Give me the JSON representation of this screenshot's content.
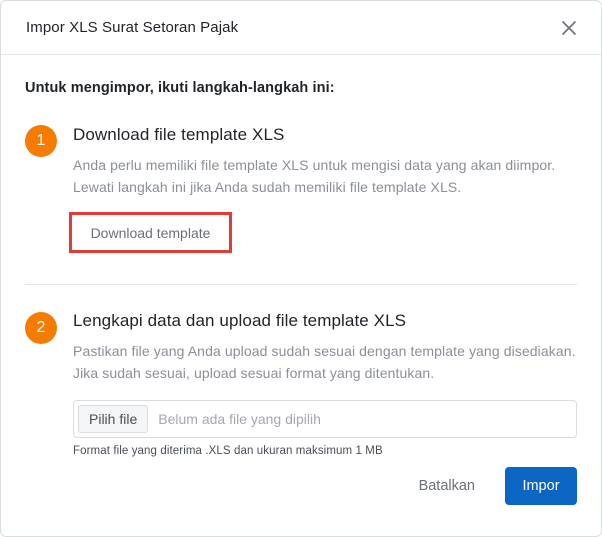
{
  "dialog": {
    "title": "Impor XLS Surat Setoran Pajak",
    "close_icon": "close-icon"
  },
  "intro": "Untuk mengimpor, ikuti langkah-langkah ini:",
  "steps": [
    {
      "number": "1",
      "title": "Download file template XLS",
      "description": "Anda perlu memiliki file template XLS untuk mengisi data yang akan diimpor. Lewati langkah ini jika Anda sudah memiliki file template XLS.",
      "button_label": "Download template"
    },
    {
      "number": "2",
      "title": "Lengkapi data dan upload file template XLS",
      "description": "Pastikan file yang Anda upload sudah sesuai dengan template yang disediakan. Jika sudah sesuai, upload sesuai format yang ditentukan.",
      "file_button_label": "Pilih file",
      "file_placeholder": "Belum ada file yang dipilih",
      "file_hint": "Format file yang diterima .XLS dan ukuran maksimum 1 MB"
    }
  ],
  "footer": {
    "cancel_label": "Batalkan",
    "submit_label": "Impor"
  },
  "colors": {
    "step_badge": "#f57c00",
    "primary": "#0a66c2",
    "highlight_border": "#e53935"
  }
}
